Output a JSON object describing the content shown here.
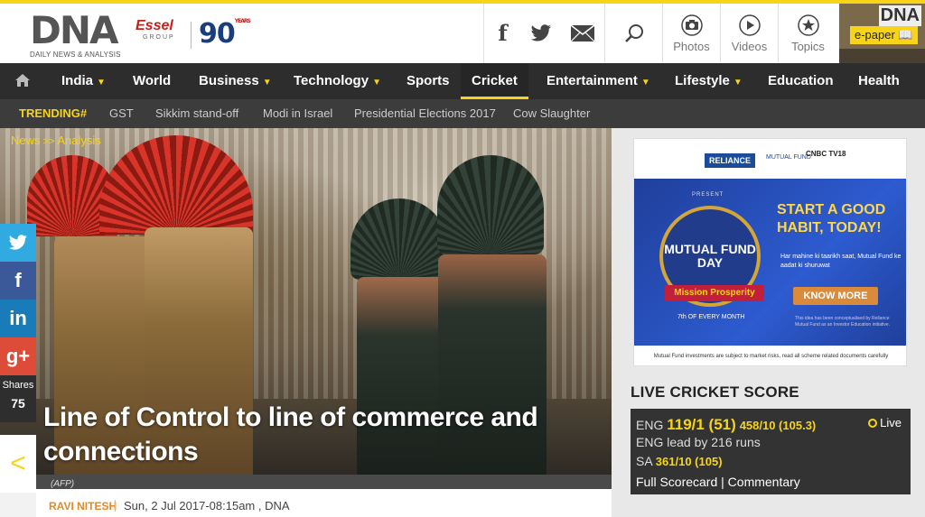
{
  "brand": {
    "logo": "DNA",
    "tagline": "DAILY NEWS & ANALYSIS",
    "essel": "Essel",
    "essel_group": "GROUP",
    "ninety": "90",
    "ninety_sup": "YEARS"
  },
  "header": {
    "facebook_icon": "f",
    "twitter_icon": "twitter-bird",
    "mail_icon": "envelope",
    "search_icon": "magnifier",
    "photos_label": "Photos",
    "videos_label": "Videos",
    "topics_label": "Topics",
    "epaper_logo": "DNA",
    "epaper_label": "e-paper"
  },
  "nav": {
    "items": [
      {
        "label": "India",
        "dropdown": true
      },
      {
        "label": "World",
        "dropdown": false
      },
      {
        "label": "Business",
        "dropdown": true
      },
      {
        "label": "Technology",
        "dropdown": true
      },
      {
        "label": "Sports",
        "dropdown": false
      },
      {
        "label": "Cricket",
        "dropdown": false,
        "active": true
      },
      {
        "label": "Entertainment",
        "dropdown": true
      },
      {
        "label": "Lifestyle",
        "dropdown": true
      },
      {
        "label": "Education",
        "dropdown": false
      },
      {
        "label": "Health",
        "dropdown": false
      }
    ],
    "caret": "▼"
  },
  "trending": {
    "label": "TRENDING#",
    "items": [
      "GST",
      "Sikkim stand-off",
      "Modi in Israel",
      "Presidential Elections 2017",
      "Cow Slaughter"
    ]
  },
  "article": {
    "breadcrumb": [
      "News",
      "Analysis"
    ],
    "breadcrumb_sep": ">>",
    "headline": "Line of Control to line of commerce and connections",
    "photo_credit": "(AFP)",
    "author": "RAVI NITESH",
    "dateline": "Sun, 2 Jul 2017-08:15am , DNA"
  },
  "share": {
    "twitter": "t",
    "facebook": "f",
    "linkedin": "in",
    "googleplus": "g+",
    "shares_label": "Shares",
    "shares_count": "75",
    "prev_arrow": "<"
  },
  "ad": {
    "reliance": "RELIANCE",
    "mutual_fund": "MUTUAL FUND",
    "cnbc": "CNBC TV18",
    "present": "PRESENT",
    "badge": "MUTUAL FUND DAY",
    "ribbon": "Mission Prosperity",
    "monthly": "7th OF EVERY MONTH",
    "headline": "START A GOOD HABIT, TODAY!",
    "sub": "Har mahine ki taarikh saat, Mutual Fund ke aadat ki shuruwat",
    "button": "KNOW MORE",
    "small": "This idea has been conceptualised by Reliance Mutual Fund as an Investor Education initiative.",
    "footer": "Mutual Fund investments are subject to market risks, read all scheme related documents carefully"
  },
  "cricket": {
    "title": "LIVE CRICKET SCORE",
    "team1": "ENG",
    "team1_score": "119/1 (51)",
    "team1_prev": "458/10 (105.3)",
    "live_label": "Live",
    "lead": "ENG lead by 216 runs",
    "team2": "SA",
    "team2_score": "361/10 (105)",
    "links": "Full Scorecard | Commentary"
  }
}
